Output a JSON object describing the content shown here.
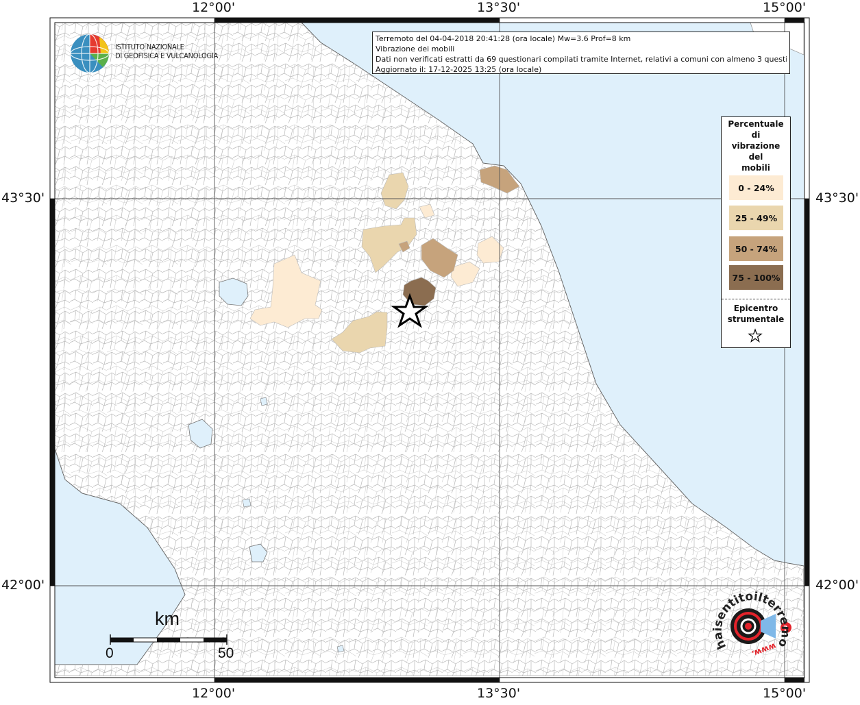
{
  "info": {
    "line1": "Terremoto del 04-04-2018 20:41:28 (ora locale) Mw=3.6 Prof=8 km",
    "line2": "Vibrazione dei mobili",
    "line3": "Dati non verificati estratti da 69 questionari compilati tramite Internet, relativi a comuni con almeno 3 questionari",
    "line4": "Aggiornato il: 17-12-2025 13:25 (ora locale)"
  },
  "logo": {
    "line1": "ISTITUTO NAZIONALE",
    "line2": "DI GEOFISICA E VULCANOLOGIA"
  },
  "axes": {
    "lon_labels": [
      "12°00'",
      "13°30'",
      "15°00'"
    ],
    "lat_labels": [
      "43°30'",
      "42°00'"
    ]
  },
  "legend": {
    "title": [
      "Percentuale",
      "di",
      "vibrazione",
      "del",
      "mobili"
    ],
    "classes": [
      {
        "label": "0 - 24%",
        "color": "#fdebd3"
      },
      {
        "label": "25 - 49%",
        "color": "#ead6ae"
      },
      {
        "label": "50 - 74%",
        "color": "#c6a37c"
      },
      {
        "label": "75 - 100%",
        "color": "#8b6d50"
      }
    ],
    "epicenter_title": [
      "Epicentro",
      "strumentale"
    ]
  },
  "scalebar": {
    "unit": "km",
    "start": "0",
    "end": "50"
  },
  "watermark": {
    "text": "haisentitoilterremoto.it",
    "prefix": "www."
  },
  "colors": {
    "sea": "#dff0fb",
    "land": "#ffffff",
    "borders": "#9a9a9a",
    "grid": "#555555"
  }
}
